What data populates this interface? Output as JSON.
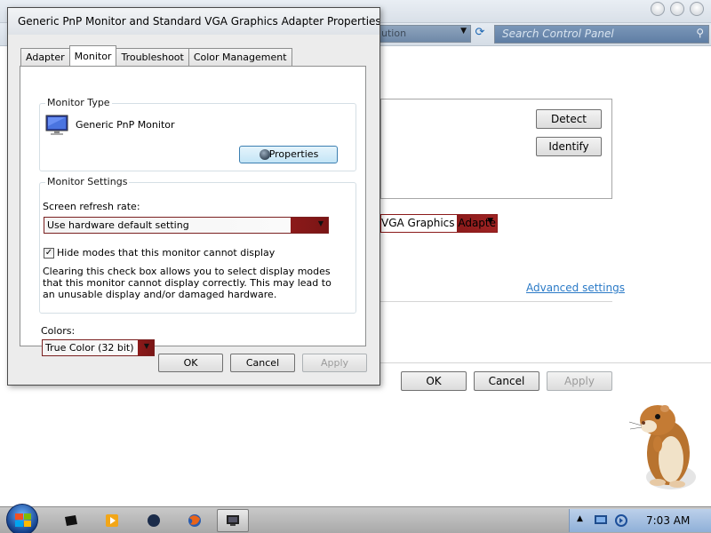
{
  "background_window": {
    "address_text": "ution",
    "search_placeholder": "Search Control Panel",
    "detect_label": "Detect",
    "identify_label": "Identify",
    "display_select_value": "VGA Graphics Adapter",
    "advanced_settings_link": "Advanced settings",
    "ok_label": "OK",
    "cancel_label": "Cancel",
    "apply_label": "Apply"
  },
  "dialog": {
    "title": "Generic PnP Monitor and Standard VGA Graphics Adapter Properties",
    "tabs": [
      {
        "label": "Adapter"
      },
      {
        "label": "Monitor",
        "active": true
      },
      {
        "label": "Troubleshoot"
      },
      {
        "label": "Color Management"
      }
    ],
    "monitor_type": {
      "group_label": "Monitor Type",
      "monitor_name": "Generic PnP Monitor",
      "properties_button": "Properties"
    },
    "monitor_settings": {
      "group_label": "Monitor Settings",
      "refresh_rate_label": "Screen refresh rate:",
      "refresh_rate_value": "Use hardware default setting",
      "hide_modes_label": "Hide modes that this monitor cannot display",
      "hide_modes_checked": true,
      "hide_modes_mark": "✓",
      "description": "Clearing this check box allows you to select display modes that this monitor cannot display correctly. This may lead to an unusable display and/or damaged hardware."
    },
    "colors": {
      "label": "Colors:",
      "value": "True Color (32 bit)"
    },
    "buttons": {
      "ok": "OK",
      "cancel": "Cancel",
      "apply": "Apply"
    }
  },
  "taskbar": {
    "items": [
      {
        "name": "start-button"
      },
      {
        "name": "taskbar-app-1"
      },
      {
        "name": "taskbar-media-player"
      },
      {
        "name": "taskbar-app-3"
      },
      {
        "name": "taskbar-firefox"
      },
      {
        "name": "taskbar-display-settings",
        "active": true
      }
    ],
    "clock": "7:03 AM"
  },
  "colors": {
    "select_accent": "#8c1a1a",
    "link": "#2a7ac7",
    "focus_button": "#3c7fb1"
  }
}
